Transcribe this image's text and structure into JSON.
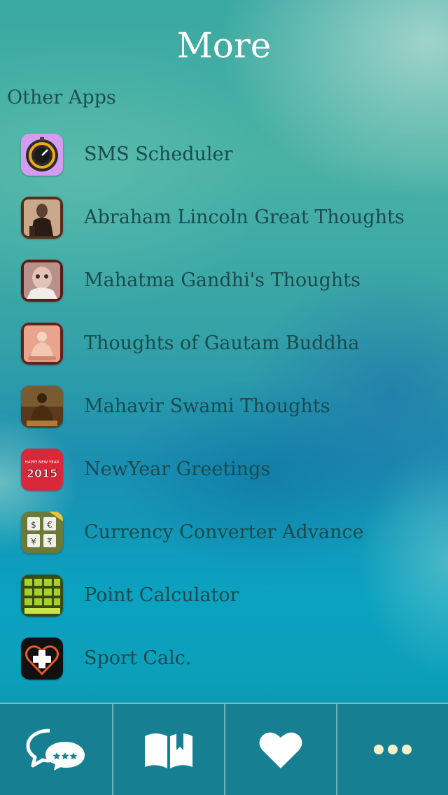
{
  "header": {
    "title": "More"
  },
  "section": {
    "label": "Other Apps"
  },
  "apps": [
    {
      "name": "SMS Scheduler",
      "icon": "stopwatch-icon"
    },
    {
      "name": "Abraham Lincoln Great Thoughts",
      "icon": "lincoln-portrait-icon"
    },
    {
      "name": "Mahatma Gandhi's Thoughts",
      "icon": "gandhi-portrait-icon"
    },
    {
      "name": "Thoughts of Gautam Buddha",
      "icon": "buddha-icon"
    },
    {
      "name": "Mahavir Swami Thoughts",
      "icon": "mahavir-statue-icon"
    },
    {
      "name": "NewYear Greetings",
      "icon": "new-year-2015-icon",
      "icon_text_top": "HAPPY NEW YEAR",
      "icon_text_year": "2015"
    },
    {
      "name": "Currency Converter Advance",
      "icon": "currency-keypad-icon",
      "icon_symbols": [
        "$",
        "€",
        "¥",
        "₹"
      ]
    },
    {
      "name": "Point Calculator",
      "icon": "point-calculator-icon"
    },
    {
      "name": "Sport Calc.",
      "icon": "sport-heart-plus-icon"
    }
  ],
  "tabbar": {
    "tabs": [
      {
        "name": "tab-quotes",
        "icon": "chat-bubbles-stars-icon"
      },
      {
        "name": "tab-categories",
        "icon": "open-book-icon"
      },
      {
        "name": "tab-favorites",
        "icon": "heart-icon"
      },
      {
        "name": "tab-more",
        "icon": "more-dots-icon"
      }
    ]
  },
  "colors": {
    "title": "#ffffff",
    "text": "#1a4a4e",
    "tabbar": "#167f92",
    "tab_icon": "#ffffff",
    "more_dots": "#f2f1c8"
  }
}
